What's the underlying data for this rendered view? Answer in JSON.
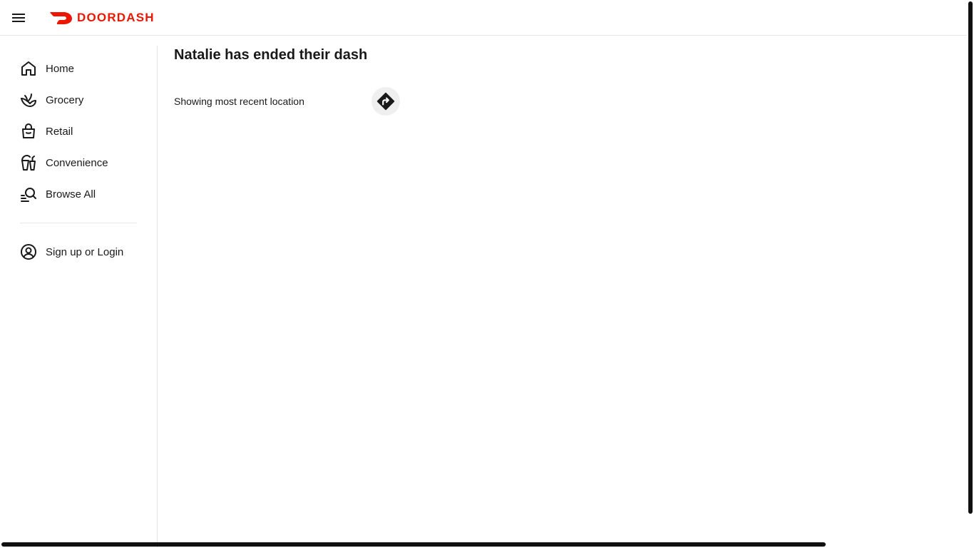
{
  "header": {
    "brand": "DOORDASH",
    "brand_color": "#eb1700",
    "menu_icon": "hamburger-icon"
  },
  "sidebar": {
    "items": [
      {
        "label": "Home",
        "icon": "home-icon"
      },
      {
        "label": "Grocery",
        "icon": "grocery-icon"
      },
      {
        "label": "Retail",
        "icon": "shopping-bag-icon"
      },
      {
        "label": "Convenience",
        "icon": "convenience-icon"
      },
      {
        "label": "Browse All",
        "icon": "browse-search-icon"
      }
    ],
    "account": {
      "label": "Sign up or Login",
      "icon": "user-circle-icon"
    }
  },
  "main": {
    "title": "Natalie has ended their dash",
    "status": "Showing most recent location",
    "directions_icon": "directions-icon"
  }
}
